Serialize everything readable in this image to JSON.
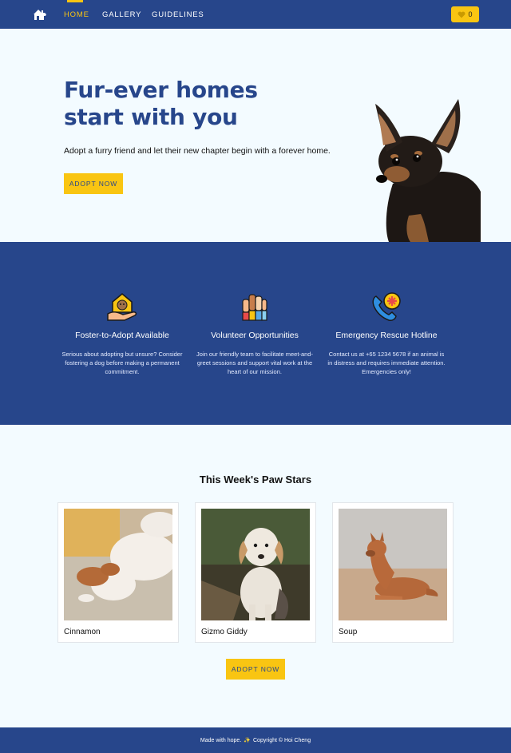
{
  "nav": {
    "links": [
      {
        "label": "HOME"
      },
      {
        "label": "GALLERY"
      },
      {
        "label": "GUIDELINES"
      }
    ],
    "favorites_count": "0",
    "accent_color": "#f9c512",
    "brand_color": "#27468b"
  },
  "hero": {
    "title_line1": "Fur-ever homes",
    "title_line2": "start with you",
    "subtitle": "Adopt a furry friend and let their new chapter begin with a forever home.",
    "cta_label": "ADOPT NOW"
  },
  "features": [
    {
      "icon": "hand-house-dog-icon",
      "title": "Foster-to-Adopt Available",
      "text": "Serious about adopting but unsure? Consider fostering a dog before making a permanent commitment."
    },
    {
      "icon": "raised-hands-icon",
      "title": "Volunteer Opportunities",
      "text": "Join our friendly team to facilitate meet-and-greet sessions and support vital work at the heart of our mission."
    },
    {
      "icon": "phone-emergency-icon",
      "title": "Emergency Rescue Hotline",
      "text": "Contact us at +65 1234 5678 if an animal is in distress and requires immediate attention. Emergencies only!"
    }
  ],
  "stars": {
    "title": "This Week's Paw Stars",
    "cards": [
      {
        "name": "Cinnamon"
      },
      {
        "name": "Gizmo Giddy"
      },
      {
        "name": "Soup"
      }
    ],
    "cta_label": "ADOPT NOW"
  },
  "footer": {
    "prefix": "Made with hope.",
    "suffix": "Copyright © Hoi Cheng"
  }
}
